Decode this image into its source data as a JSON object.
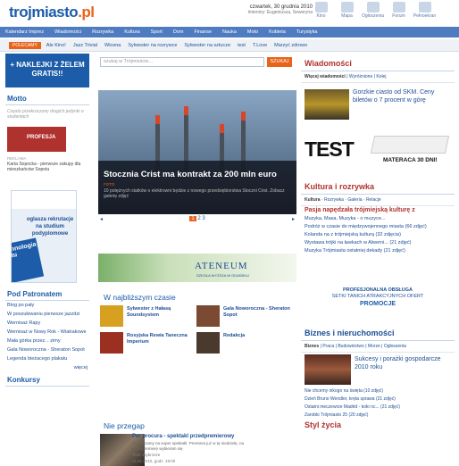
{
  "header": {
    "logo_main": "trojmiasto",
    "logo_ext": ".pl",
    "date": "czwartek, 30 grudnia 2010",
    "names": "Imieniny: Eugeniusza, Sewerynа",
    "icons": [
      {
        "label": "Kino",
        "icon": "film-icon"
      },
      {
        "label": "Mapa",
        "icon": "map-icon"
      },
      {
        "label": "Ogłoszenia",
        "icon": "megaphone-icon"
      },
      {
        "label": "Forum",
        "icon": "forum-icon"
      },
      {
        "label": "Pełnoekran",
        "icon": "monitor-icon"
      }
    ]
  },
  "nav": {
    "items": [
      "Kalendarz Imprez",
      "Wiadomości",
      "Rozrywka",
      "Kultura",
      "Sport",
      "Dom",
      "Finanse",
      "Nauka",
      "Moto",
      "Kobieta",
      "Turystyka"
    ]
  },
  "subnav": {
    "tag": "POLECAMY",
    "links": [
      "Ale Kino!",
      "Jazz Trivial",
      "Wiosna",
      "Sylwester na rozrywce",
      "Sylwester na sztucze",
      "test",
      "T.Love",
      "Marzyć zdrowo"
    ]
  },
  "left": {
    "promo": "+ NAKLEJKI Z ŻELEM GRATIS!!",
    "motto_title": "Motto",
    "motto_text": "Często przekroczony drugich jedynki o studentach",
    "profesja": "PROFESJA",
    "rekl_label": "REKLAMA",
    "karta": "Karta Sopocka - pierwsze zakupy dla mieszkańców Sopotu",
    "zabka": "oglasza rekrutacje na studium podyplomowe",
    "zabka_side": "echnologia ortu",
    "patronat_title": "Pod Patronatem",
    "patronat": [
      "Blog po pały",
      "W poszukiwaniu pierwsze jazzdzi",
      "Wernisaż Rapy",
      "Wernisaż w Nowy Rok - Wiatrakowe",
      "Mała górka przez... zimy",
      "Gala Noworoczna - Sheraton Sopot",
      "Legenda bieżacego plakatu"
    ],
    "wiecej": "więcej",
    "konkursy_title": "Konkursy"
  },
  "center": {
    "search_placeholder": "szukaj w Trójmieście...",
    "search_button": "SZUKAJ",
    "hero": {
      "title": "Stocznia Crist ma kontrakt za 200 mln euro",
      "source": "FOTO",
      "desc": "10 potężnych statków o elektrowni będzie z nowego przedsiębiorstwa Stoczni Crist. Zobacz galerię zdjęć"
    },
    "pages": [
      "1",
      "2",
      "3"
    ],
    "ateneum_title": "ATENEUM",
    "ateneum_sub": "SZKOŁA WYŻSZA W GDAŃSKU",
    "najblizszym_title": "W najbliższym czasie",
    "events": [
      {
        "title": "Sylwester z Hałasą Soundsystem",
        "sub": "Pod Hala Gdańsk"
      },
      {
        "title": "Gala Noworoczna - Sheraton Sopot",
        "sub": ""
      },
      {
        "title": "Rosyjska Rewia Taneczna Imperium",
        "sub": "Teatr Wybrzeże"
      },
      {
        "title": "Redakcja",
        "sub": "Róż, Gdynia"
      }
    ],
    "przegap_title": "Nie przegap",
    "przegap": {
      "title": "Per procura - spektakl przedpremierowy",
      "desc": "Zapraszamy na super spektakl. Premiera już w tę niedzielę, na przedpremierę wybieram się",
      "place": "Teatr Wybrzeże",
      "date": "11.01.2010, godz. 19:00"
    }
  },
  "right": {
    "wiadomosci_title": "Wiadomości",
    "wiadomosci_tabs": [
      "Więcej wiadomości",
      "Wyróżnione",
      "Kolej"
    ],
    "news_top": "Gorzkie ciasto od SKM. Ceny biletów o 7 procent w górę",
    "test_title": "TEST",
    "test_sub": "MATERACA 30 DNI!",
    "kultura_title": "Kultura i rozrywka",
    "kultura_tabs": [
      "Kultura",
      "Rozrywka",
      "Galeria",
      "Relacje"
    ],
    "kultura_main": "Pasja napędzała trójmiejską kulturę z",
    "kultura_items": [
      "Muzyka, Masa, Muzyka - o muzyce...",
      "Podróż w czasie do międzywojennego miasta (66 zdjęć)",
      "Kolanda na z trójmiejską kulturą (32 zdjęcia)",
      "Wystawa trójki na ławkach w Alwerni... (21 zdjęć)",
      "Muzyka Trójmiasta ostatniej dekady (21 zdjęć)"
    ],
    "prof_a": "PROFESJONALNA OBSŁUGA",
    "prof_b": "SETKI TANICH ATRAKCYJNYCH OFERT",
    "prof_c": "PROMOCJE",
    "biznes_title": "Biznes i nieruchomości",
    "biznes_tabs": [
      "Biznes",
      "Praca",
      "Budownictwo",
      "Morze",
      "Ogłoszenia"
    ],
    "biznes_main": "Sukcesy i porażki gospodarcze 2010 roku",
    "biznes_items": [
      "Nie chcemy nikogo na święta (10 zdjęć)",
      "Dzień Bruno Wendler, kręta sprawa (21 zdjęć)",
      "Ostatni meczewrze Madrid - koło nc... (21 zdjęć)",
      "Zarobki Trójmiasto 25 (20 zdjęć)"
    ],
    "styl_title": "Styl życia"
  }
}
